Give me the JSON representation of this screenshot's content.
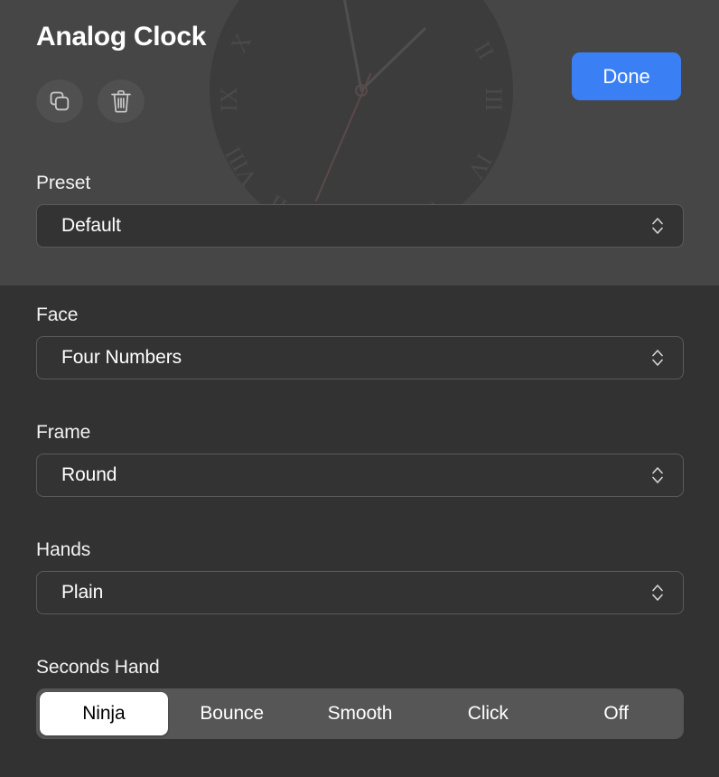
{
  "header": {
    "title": "Analog Clock",
    "watermark_icon": "analog-clock-face-watermark",
    "actions": [
      {
        "icon": "duplicate-icon",
        "name": "duplicate-button"
      },
      {
        "icon": "trash-icon",
        "name": "delete-button"
      }
    ],
    "done_label": "Done"
  },
  "preset": {
    "label": "Preset",
    "value": "Default",
    "stepper_icon": "chevron-up-down-icon"
  },
  "face": {
    "label": "Face",
    "value": "Four Numbers",
    "stepper_icon": "chevron-up-down-icon"
  },
  "frame": {
    "label": "Frame",
    "value": "Round",
    "stepper_icon": "chevron-up-down-icon"
  },
  "hands": {
    "label": "Hands",
    "value": "Plain",
    "stepper_icon": "chevron-up-down-icon"
  },
  "seconds_hand": {
    "label": "Seconds Hand",
    "selected": "Ninja",
    "options": [
      {
        "label": "Ninja",
        "selected": true
      },
      {
        "label": "Bounce",
        "selected": false
      },
      {
        "label": "Smooth",
        "selected": false
      },
      {
        "label": "Click",
        "selected": false
      },
      {
        "label": "Off",
        "selected": false
      }
    ]
  },
  "colors": {
    "header_band": "#464646",
    "body_band": "#323232",
    "field_bg": "#333333",
    "field_border": "#5a5a5a",
    "accent": "#3b7ff5",
    "segment_track": "#565656",
    "segment_selected_bg": "#ffffff",
    "segment_selected_text": "#000000",
    "text": "#ffffff"
  }
}
